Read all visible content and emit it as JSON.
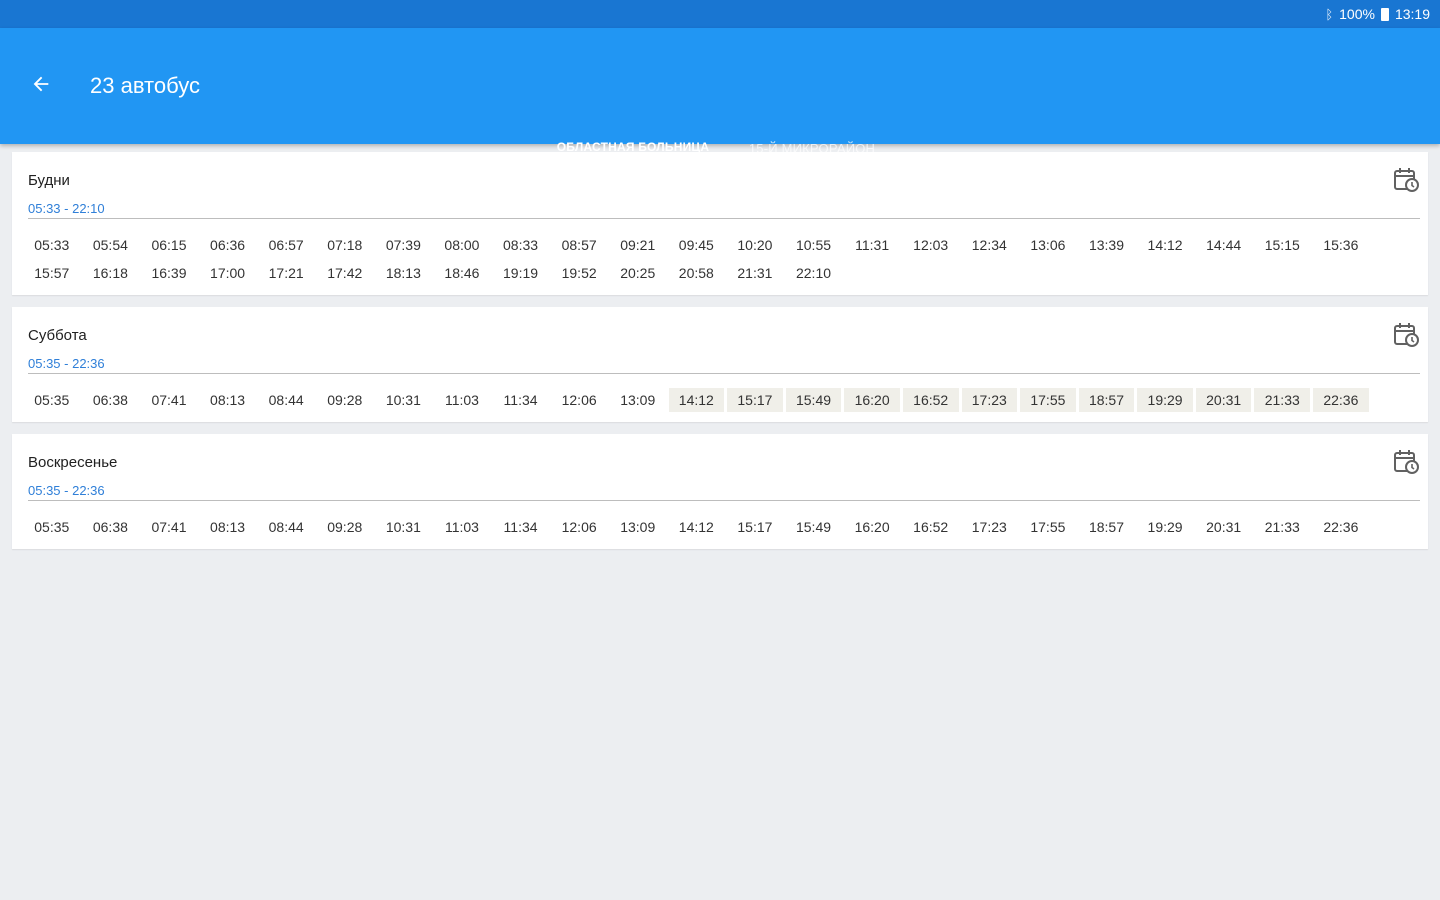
{
  "status": {
    "battery": "100%",
    "time": "13:19"
  },
  "header": {
    "title": "23 автобус"
  },
  "tabs": [
    {
      "label": "Областная больница",
      "active": true
    },
    {
      "label": "15-й микрорайон",
      "active": false
    }
  ],
  "schedules": [
    {
      "day": "Будни",
      "range": "05:33 - 22:10",
      "highlight_from": 99,
      "times": [
        "05:33",
        "05:54",
        "06:15",
        "06:36",
        "06:57",
        "07:18",
        "07:39",
        "08:00",
        "08:33",
        "08:57",
        "09:21",
        "09:45",
        "10:20",
        "10:55",
        "11:31",
        "12:03",
        "12:34",
        "13:06",
        "13:39",
        "14:12",
        "14:44",
        "15:15",
        "15:36",
        "15:57",
        "16:18",
        "16:39",
        "17:00",
        "17:21",
        "17:42",
        "18:13",
        "18:46",
        "19:19",
        "19:52",
        "20:25",
        "20:58",
        "21:31",
        "22:10"
      ]
    },
    {
      "day": "Суббота",
      "range": "05:35 - 22:36",
      "highlight_from": 11,
      "times": [
        "05:35",
        "06:38",
        "07:41",
        "08:13",
        "08:44",
        "09:28",
        "10:31",
        "11:03",
        "11:34",
        "12:06",
        "13:09",
        "14:12",
        "15:17",
        "15:49",
        "16:20",
        "16:52",
        "17:23",
        "17:55",
        "18:57",
        "19:29",
        "20:31",
        "21:33",
        "22:36"
      ]
    },
    {
      "day": "Воскресенье",
      "range": "05:35 - 22:36",
      "highlight_from": 99,
      "times": [
        "05:35",
        "06:38",
        "07:41",
        "08:13",
        "08:44",
        "09:28",
        "10:31",
        "11:03",
        "11:34",
        "12:06",
        "13:09",
        "14:12",
        "15:17",
        "15:49",
        "16:20",
        "16:52",
        "17:23",
        "17:55",
        "18:57",
        "19:29",
        "20:31",
        "21:33",
        "22:36"
      ]
    }
  ],
  "colors": {
    "primary": "#2196F3",
    "primary_dark": "#1976D2",
    "range_text": "#2F7FD8",
    "highlight": "#F0EFE9"
  }
}
